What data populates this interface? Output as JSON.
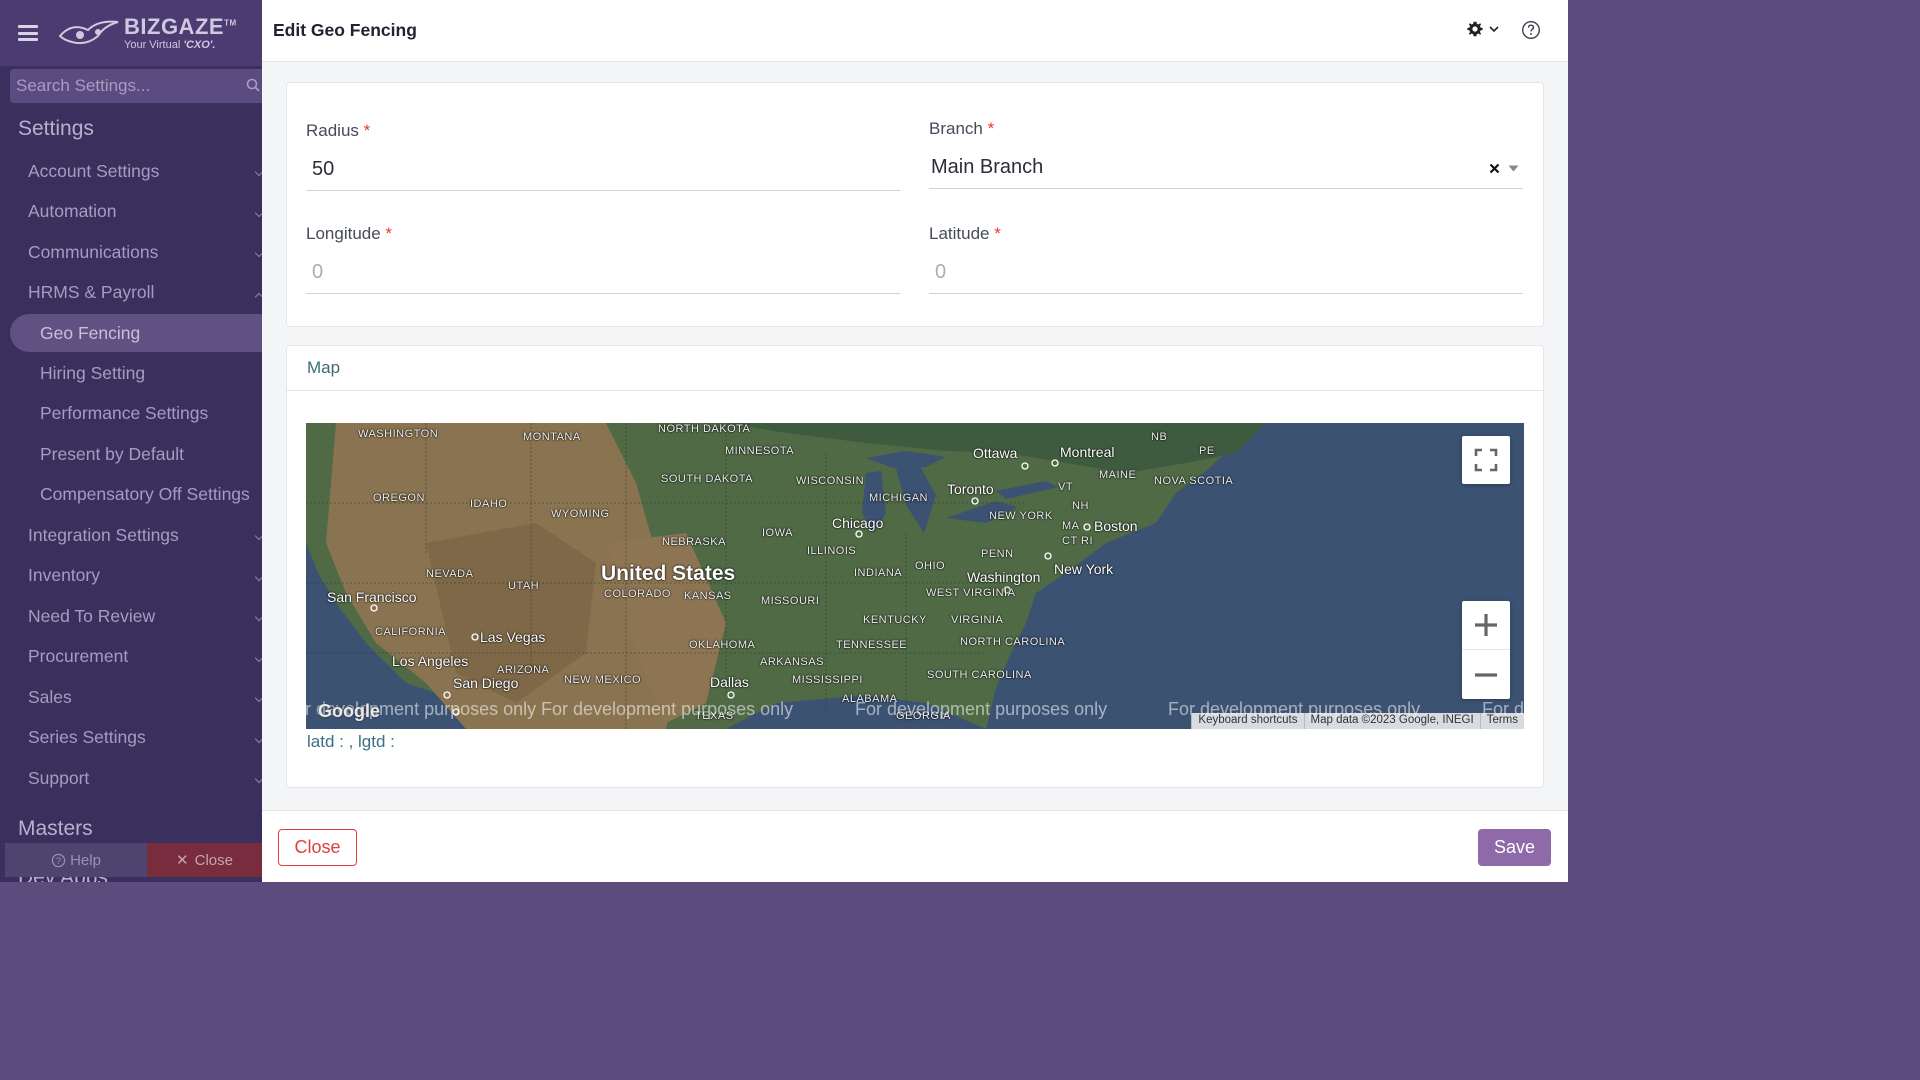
{
  "brand": {
    "name": "BIZGAZE",
    "trademark": "TM",
    "tagline_prefix": "Your Virtual ",
    "tagline_emphasis": "'CXO'."
  },
  "search": {
    "placeholder": "Search Settings..."
  },
  "sidebar": {
    "section_title": "Settings",
    "items": [
      {
        "label": "Account Settings"
      },
      {
        "label": "Automation"
      },
      {
        "label": "Communications"
      },
      {
        "label": "HRMS & Payroll"
      },
      {
        "label": "Geo Fencing",
        "active": true
      },
      {
        "label": "Hiring Setting"
      },
      {
        "label": "Performance Settings"
      },
      {
        "label": "Present by Default"
      },
      {
        "label": "Compensatory Off Settings"
      },
      {
        "label": "Integration Settings"
      },
      {
        "label": "Inventory"
      },
      {
        "label": "Need To Review"
      },
      {
        "label": "Procurement"
      },
      {
        "label": "Sales"
      },
      {
        "label": "Series Settings"
      },
      {
        "label": "Support"
      }
    ],
    "masters_title": "Masters",
    "devapps_title": "Dev Apps",
    "help_label": "Help",
    "close_label": "Close"
  },
  "header": {
    "title": "Edit Geo Fencing"
  },
  "form": {
    "radius": {
      "label": "Radius",
      "required": "*",
      "value": "50"
    },
    "branch": {
      "label": "Branch",
      "required": "*",
      "value": "Main Branch"
    },
    "longitude": {
      "label": "Longitude",
      "required": "*",
      "placeholder": "0"
    },
    "latitude": {
      "label": "Latitude",
      "required": "*",
      "placeholder": "0"
    }
  },
  "map": {
    "title": "Map",
    "country": "United States",
    "cities": [
      "Ottawa",
      "Montreal",
      "Toronto",
      "Chicago",
      "Boston",
      "New York",
      "Washington",
      "San Francisco",
      "Las Vegas",
      "Los Angeles",
      "San Diego",
      "Dallas"
    ],
    "states": [
      "WASHINGTON",
      "MONTANA",
      "NORTH DAKOTA",
      "MINNESOTA",
      "NB",
      "PE",
      "MAINE",
      "NOVA SCOTIA",
      "OREGON",
      "IDAHO",
      "SOUTH DAKOTA",
      "WISCONSIN",
      "MICHIGAN",
      "VT",
      "NH",
      "WYOMING",
      "NEW YORK",
      "MA",
      "CT",
      "RI",
      "IOWA",
      "NEBRASKA",
      "ILLINOIS",
      "OHIO",
      "PENN",
      "NEVADA",
      "UTAH",
      "COLORADO",
      "KANSAS",
      "MISSOURI",
      "INDIANA",
      "WEST VIRGINIA",
      "VIRGINIA",
      "CALIFORNIA",
      "KENTUCKY",
      "ARIZONA",
      "OKLAHOMA",
      "TENNESSEE",
      "NORTH CAROLINA",
      "NEW MEXICO",
      "ARKANSAS",
      "MISSISSIPPI",
      "SOUTH CAROLINA",
      "ALABAMA",
      "TEXAS",
      "GEORGIA"
    ],
    "watermark": "For development purposes only",
    "google_label": "Google",
    "attribution": [
      "Keyboard shortcuts",
      "Map data ©2023 Google, INEGI",
      "Terms"
    ],
    "caption": "latd : , lgtd :"
  },
  "footer": {
    "close_label": "Close",
    "save_label": "Save"
  },
  "colors": {
    "accent": "#8e6aa9",
    "danger": "#e0403a",
    "sidebar_bg": "#3b2f5e"
  }
}
